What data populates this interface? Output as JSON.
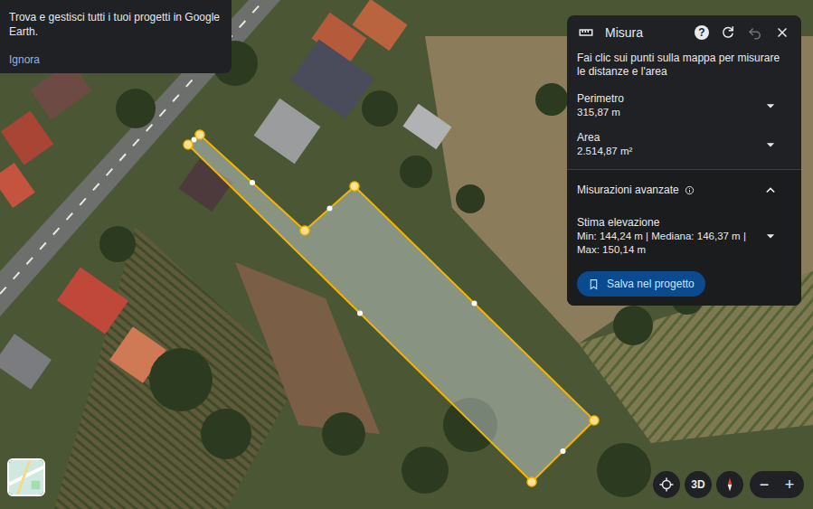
{
  "banner": {
    "text": "Trova e gestisci tutti i tuoi progetti in Google Earth.",
    "action": "Ignora"
  },
  "measure_panel": {
    "title": "Misura",
    "help_icon": "?",
    "undo_enabled": false,
    "hint": "Fai clic sui punti sulla mappa per misurare le distanze e l'area",
    "metrics": [
      {
        "label": "Perimetro",
        "value": "315,87 m",
        "expanded": false
      },
      {
        "label": "Area",
        "value": "2.514,87 m²",
        "expanded": false
      }
    ],
    "advanced": {
      "label": "Misurazioni avanzate",
      "expanded": true,
      "elevation": {
        "label": "Stima elevazione",
        "value": "Min: 144,24 m | Mediana: 146,37 m | Max: 150,14 m",
        "expanded": false
      }
    },
    "save_button": "Salva nel progetto"
  },
  "map_controls": {
    "view_3d": "3D",
    "zoom_out": "−",
    "zoom_in": "+"
  }
}
